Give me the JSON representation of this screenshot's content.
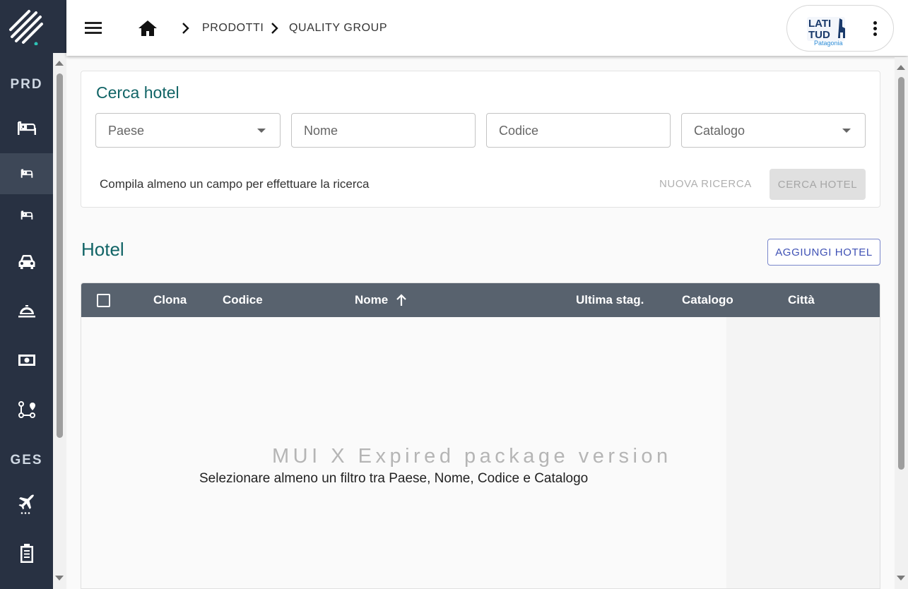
{
  "sidebar": {
    "section_prd": "PRD",
    "section_ges": "GES",
    "items": [
      {
        "icon": "bed-icon",
        "active": false
      },
      {
        "icon": "bed-small-icon",
        "active": true
      },
      {
        "icon": "bed-small-icon",
        "active": false
      },
      {
        "icon": "car-icon",
        "active": false
      },
      {
        "icon": "room-service-icon",
        "active": false
      },
      {
        "icon": "money-icon",
        "active": false
      },
      {
        "icon": "route-icon",
        "active": false
      },
      {
        "icon": "flight-icon",
        "active": false
      },
      {
        "icon": "clipboard-icon",
        "active": false
      }
    ]
  },
  "topbar": {
    "breadcrumb": [
      "PRODOTTI",
      "QUALITY GROUP"
    ],
    "user_logo_text": "LATITUD Patagonia"
  },
  "search": {
    "title": "Cerca hotel",
    "fields": {
      "paese": "Paese",
      "nome": "Nome",
      "codice": "Codice",
      "catalogo": "Catalogo"
    },
    "hint": "Compila almeno un campo per effettuare la ricerca",
    "new_search_label": "NUOVA RICERCA",
    "search_label": "CERCA HOTEL"
  },
  "hotel": {
    "title": "Hotel",
    "add_label": "AGGIUNGI HOTEL",
    "columns": [
      "Clona",
      "Codice",
      "Nome",
      "Ultima stag.",
      "Catalogo",
      "Città"
    ],
    "watermark": "MUI X Expired package version",
    "empty_message": "Selezionare almeno un filtro tra Paese, Nome, Codice e Catalogo"
  },
  "colors": {
    "sidebar_bg": "#283142",
    "accent_teal": "#116466",
    "grid_header": "#58626e",
    "outline_button": "#3f51b5"
  }
}
